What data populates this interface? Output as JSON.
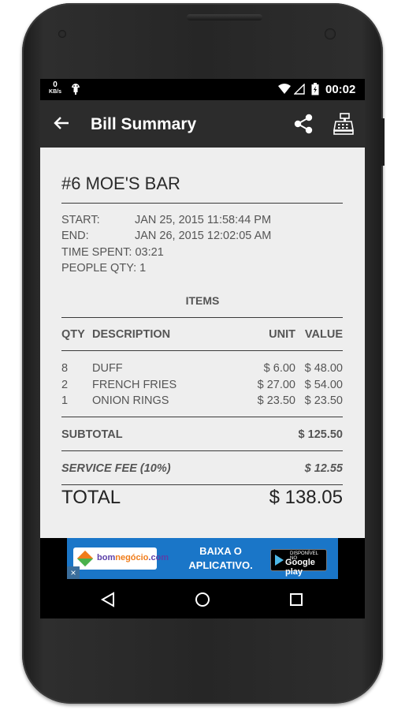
{
  "status_bar": {
    "net_speed": "0",
    "net_unit": "KB/s",
    "time": "00:02"
  },
  "app_bar": {
    "title": "Bill Summary",
    "icons": [
      "back-arrow-icon",
      "share-icon",
      "cash-register-icon"
    ]
  },
  "bill": {
    "name": "#6 MOE'S BAR",
    "start_label": "START:",
    "start_value": "JAN 25, 2015 11:58:44 PM",
    "end_label": "END:",
    "end_value": "JAN 26, 2015 12:02:05 AM",
    "time_spent_label": "TIME SPENT:",
    "time_spent_value": "03:21",
    "people_label": "PEOPLE QTY:",
    "people_value": "1"
  },
  "items_section": {
    "heading": "ITEMS",
    "columns": {
      "qty": "QTY",
      "description": "DESCRIPTION",
      "unit": "UNIT",
      "value": "VALUE"
    },
    "rows": [
      {
        "qty": "8",
        "description": "DUFF",
        "unit": "$ 6.00",
        "value": "$ 48.00"
      },
      {
        "qty": "2",
        "description": "FRENCH FRIES",
        "unit": "$ 27.00",
        "value": "$ 54.00"
      },
      {
        "qty": "1",
        "description": "ONION RINGS",
        "unit": "$ 23.50",
        "value": "$ 23.50"
      }
    ]
  },
  "totals": {
    "subtotal_label": "SUBTOTAL",
    "subtotal_value": "$ 125.50",
    "service_label": "SERVICE FEE (10%)",
    "service_value": "$ 12.55",
    "total_label": "TOTAL",
    "total_value": "$ 138.05"
  },
  "ad": {
    "brand_prefix": "bom",
    "brand_mid": "negócio",
    "brand_suffix": ".com",
    "cta_line1": "BAIXA O",
    "cta_line2": "APLICATIVO.",
    "store_small": "DISPONÍVEL NO",
    "store_name": "Google play",
    "close": "×"
  },
  "colors": {
    "app_bar": "#2c2c2c",
    "content_bg": "#eeeeee",
    "ad_bg": "#1a76c8"
  }
}
